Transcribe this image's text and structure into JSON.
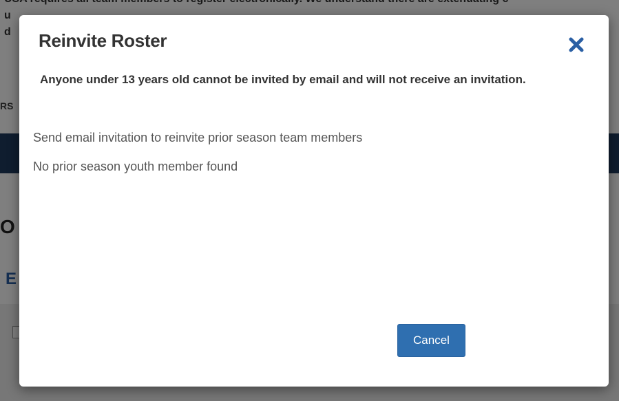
{
  "modal": {
    "title": "Reinvite Roster",
    "warning": "Anyone under 13 years old cannot be invited by email and will not receive an invitation.",
    "description_line1": "Send email invitation to reinvite prior season team members",
    "description_line2": "No prior season youth member found",
    "cancel_label": "Cancel",
    "close_icon": "close-icon"
  },
  "background": {
    "banner_line1": "USA  requires all team members to register electronically. We understand there are extenuating c",
    "banner_line2": "u",
    "banner_line3": "d",
    "left_label": "RS",
    "heading_fragment": "O",
    "blue_fragment": "E"
  },
  "colors": {
    "accent": "#2f6fb0",
    "close_icon": "#2a5fa4",
    "navbar": "#1f3a5f"
  }
}
